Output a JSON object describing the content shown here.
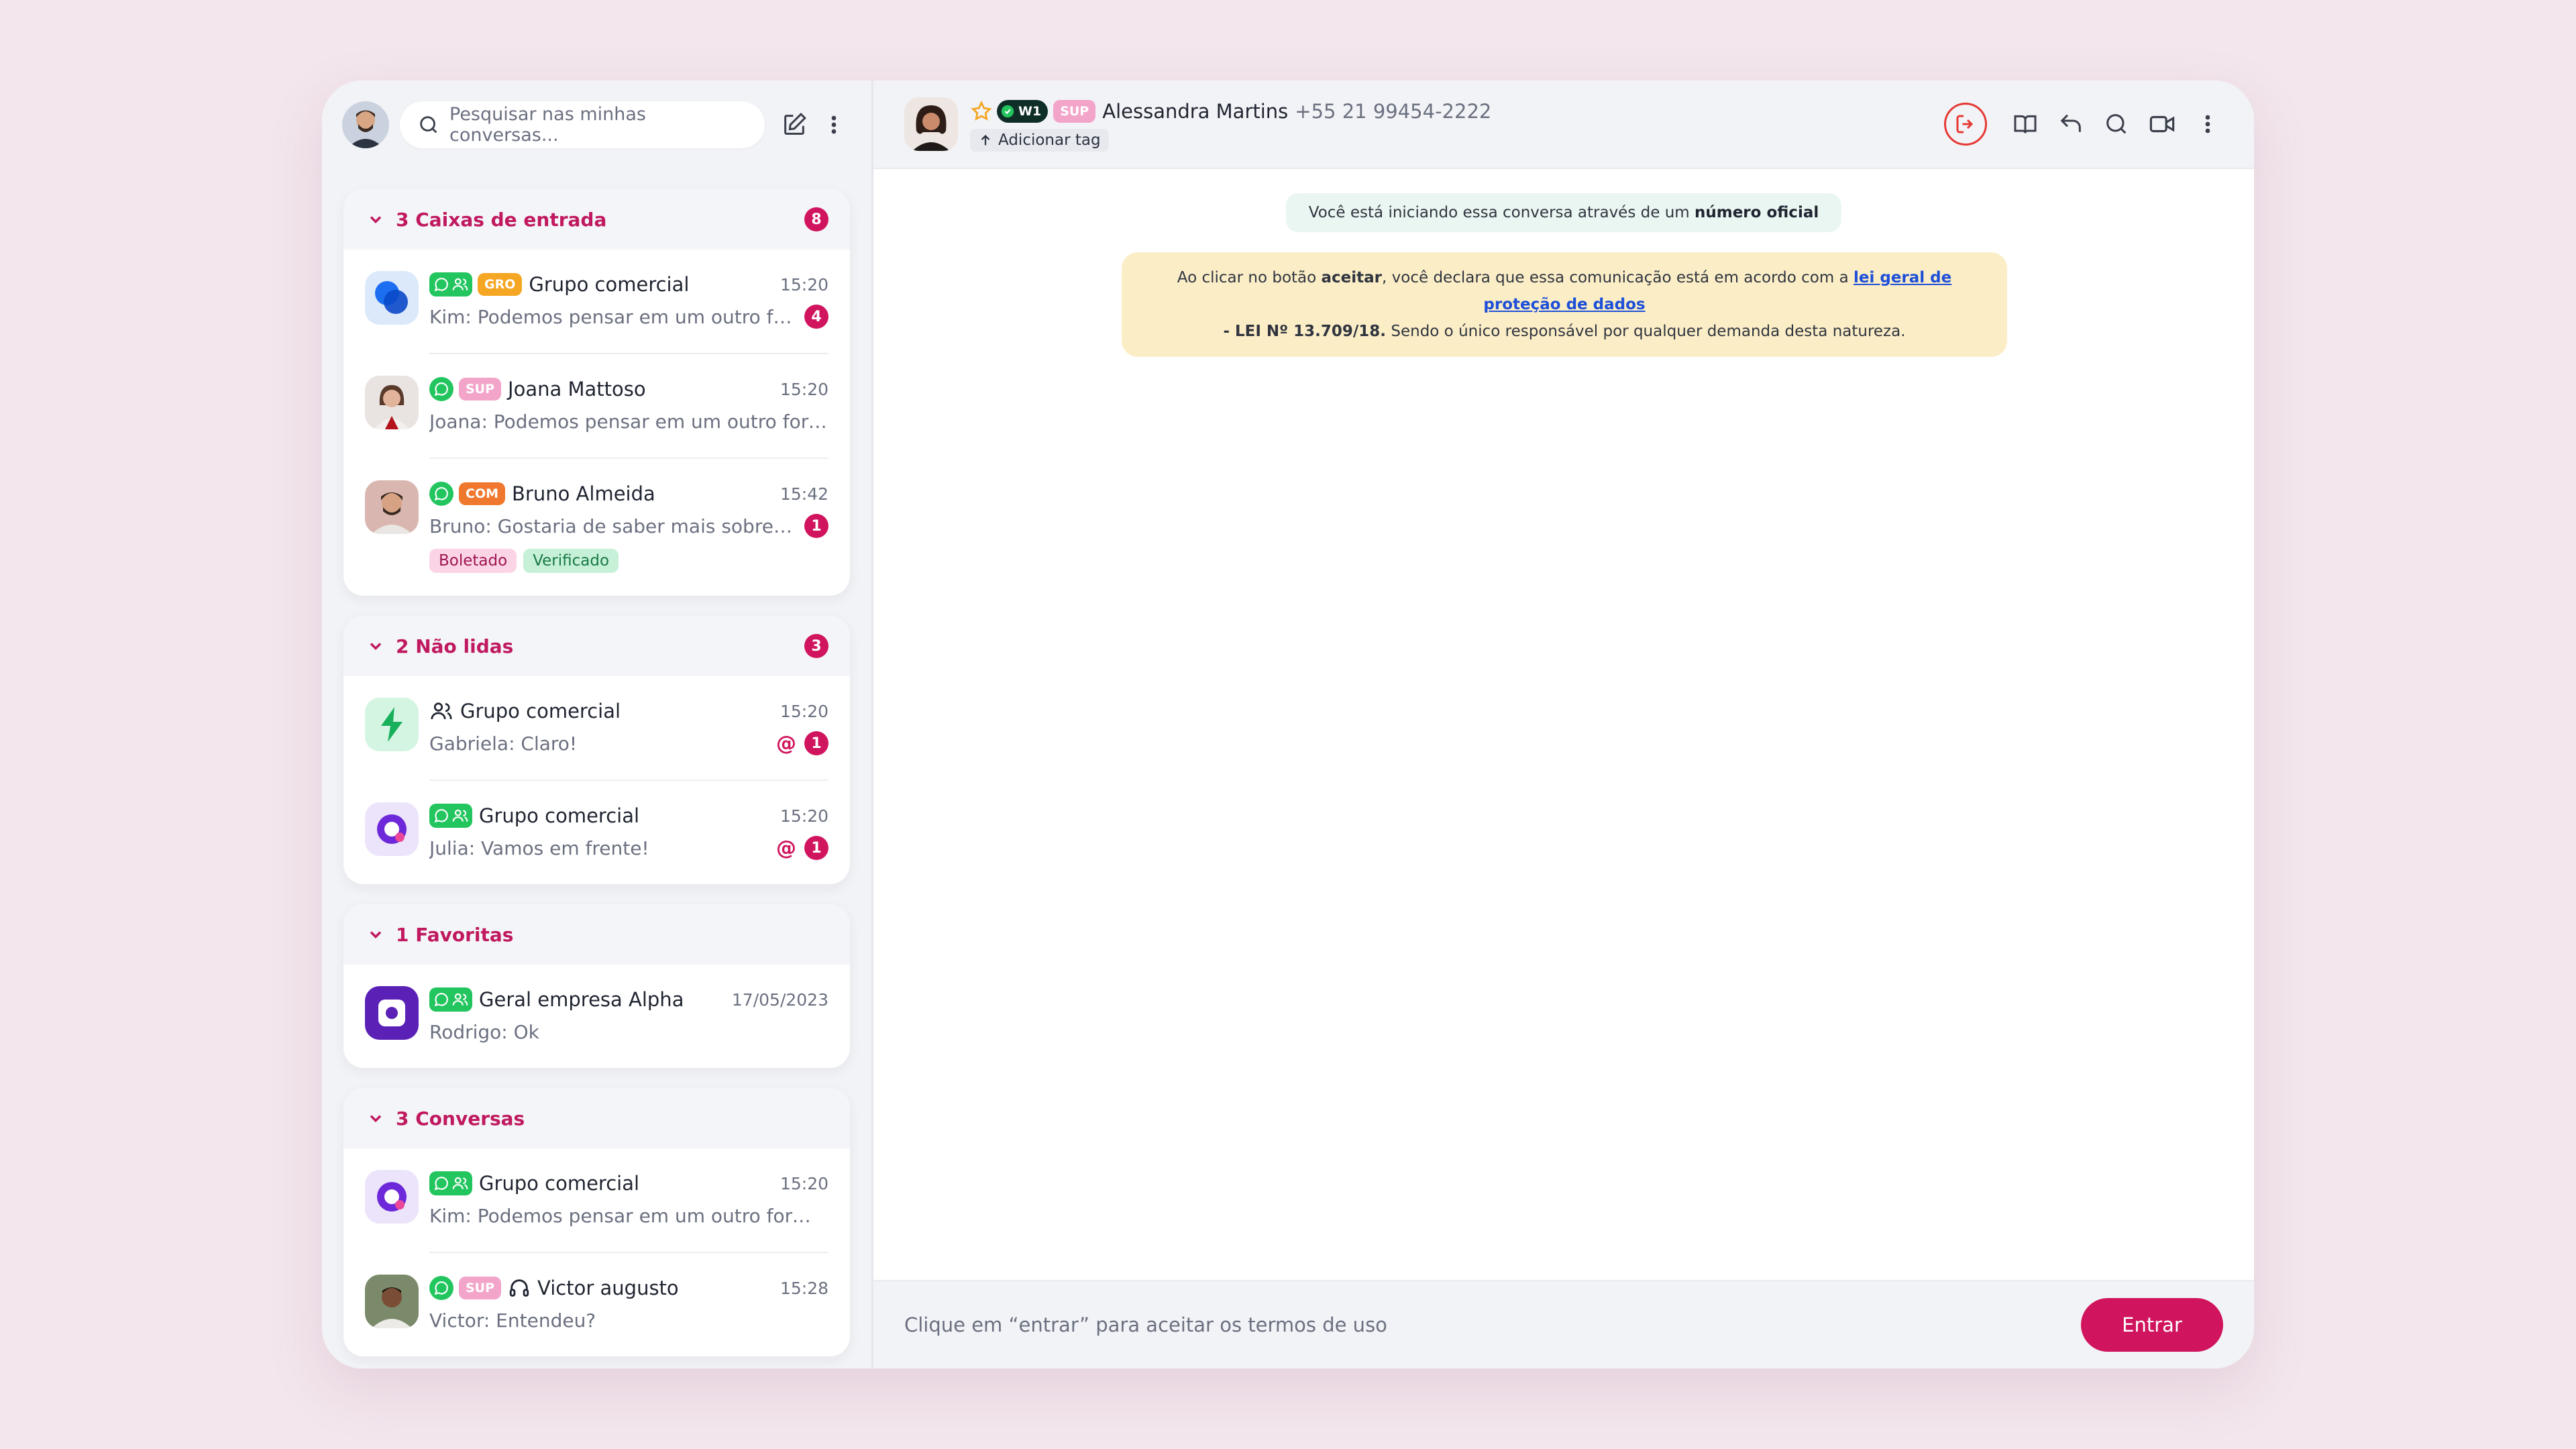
{
  "search": {
    "placeholder": "Pesquisar nas minhas conversas..."
  },
  "sections": [
    {
      "title": "3 Caixas de entrada",
      "count": "8",
      "items": [
        {
          "tag": "GRO",
          "name": "Grupo comercial",
          "time": "15:20",
          "preview": "Kim: Podemos pensar em um outro formato",
          "unread": "4"
        },
        {
          "tag": "SUP",
          "name": "Joana Mattoso",
          "time": "15:20",
          "preview": "Joana: Podemos pensar em um outro formato"
        },
        {
          "tag": "COM",
          "name": "Bruno Almeida",
          "time": "15:42",
          "preview": "Bruno: Gostaria de saber mais sobre o ser...",
          "unread": "1",
          "labels": [
            "Boletado",
            "Verificado"
          ]
        }
      ]
    },
    {
      "title": "2 Não lidas",
      "count": "3",
      "items": [
        {
          "name": "Grupo comercial",
          "time": "15:20",
          "preview": "Gabriela: Claro!",
          "mention": "@",
          "unread": "1"
        },
        {
          "name": "Grupo comercial",
          "time": "15:20",
          "preview": "Julia: Vamos em frente!",
          "mention": "@",
          "unread": "1"
        }
      ]
    },
    {
      "title": "1 Favoritas",
      "items": [
        {
          "name": "Geral empresa Alpha",
          "time": "17/05/2023",
          "preview": "Rodrigo: Ok"
        }
      ]
    },
    {
      "title": "3 Conversas",
      "items": [
        {
          "name": "Grupo comercial",
          "time": "15:20",
          "preview": "Kim: Podemos pensar em um outro formato"
        },
        {
          "tag": "SUP",
          "name": "Victor augusto",
          "time": "15:28",
          "preview": "Victor: Entendeu?"
        }
      ]
    }
  ],
  "chat": {
    "badge": "W1",
    "tag": "SUP",
    "name": "Alessandra Martins",
    "phone": "+55 21 99454-2222",
    "add_tag": "Adicionar tag",
    "notice_official_prefix": "Você está iniciando essa conversa através de um",
    "notice_official_bold": "número oficial",
    "lgpd": {
      "part1": "Ao clicar no botão",
      "bold1": "aceitar",
      "part2": ", você declara que essa comunicação está em acordo com a",
      "link": "lei geral de proteção de dados",
      "bold2": "- LEI Nº 13.709/18.",
      "part3": "Sendo o único responsável por qualquer demanda desta natureza."
    },
    "footer_hint": "Clique em “entrar” para aceitar os termos de uso",
    "enter_label": "Entrar"
  },
  "colors": {
    "accent": "#d0145d",
    "whatsapp": "#22c55e",
    "tag_gro": "#f5a623",
    "tag_sup": "#f3a5c9",
    "tag_com": "#f0782e",
    "exit": "#e53935"
  }
}
